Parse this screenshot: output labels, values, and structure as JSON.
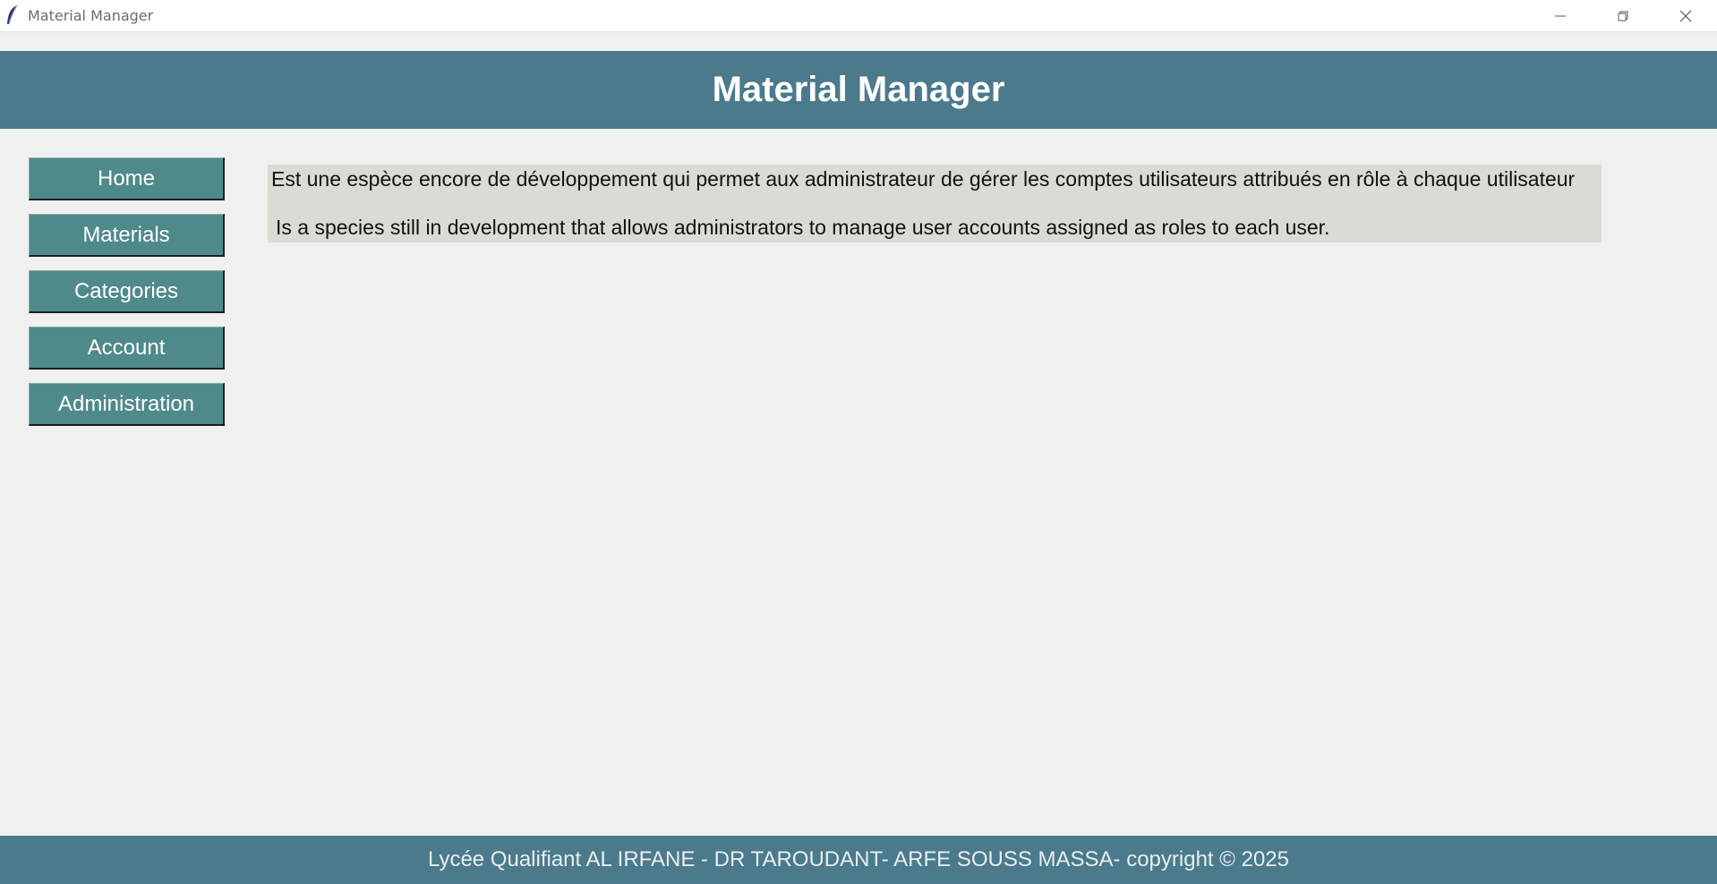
{
  "window": {
    "title": "Material Manager",
    "icons": {
      "app": "feather-icon",
      "minimize": "minimize-icon",
      "maximize": "restore-icon",
      "close": "close-icon"
    }
  },
  "header": {
    "title": "Material Manager"
  },
  "sidebar": {
    "items": [
      {
        "label": "Home"
      },
      {
        "label": "Materials"
      },
      {
        "label": "Categories"
      },
      {
        "label": "Account"
      },
      {
        "label": "Administration"
      }
    ]
  },
  "main": {
    "description_fr": "Est une espèce encore de développement qui permet aux administrateur de gérer les comptes utilisateurs attribués en rôle à chaque utilisateur",
    "description_en": "Is a species still in development that allows administrators to manage user accounts assigned as roles to each user."
  },
  "footer": {
    "text": "Lycée Qualifiant AL IRFANE - DR TAROUDANT- ARFE SOUSS MASSA-  copyright © 2025"
  },
  "colors": {
    "header_bg": "#4b7a8c",
    "button_bg": "#4f8a8b",
    "panel_bg": "#dcdad5",
    "window_bg": "#f0f0f0"
  }
}
